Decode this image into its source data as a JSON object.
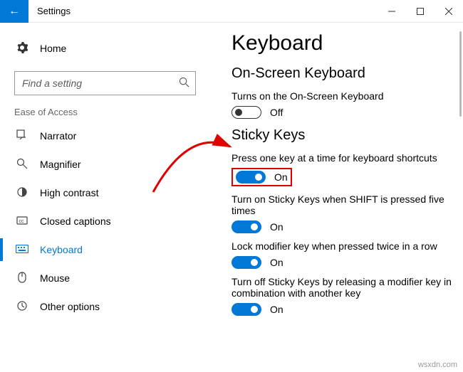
{
  "window": {
    "title": "Settings"
  },
  "sidebar": {
    "home": "Home",
    "search_placeholder": "Find a setting",
    "section": "Ease of Access",
    "items": [
      {
        "id": "narrator",
        "label": "Narrator",
        "active": false
      },
      {
        "id": "magnifier",
        "label": "Magnifier",
        "active": false
      },
      {
        "id": "high-contrast",
        "label": "High contrast",
        "active": false
      },
      {
        "id": "closed-captions",
        "label": "Closed captions",
        "active": false
      },
      {
        "id": "keyboard",
        "label": "Keyboard",
        "active": true
      },
      {
        "id": "mouse",
        "label": "Mouse",
        "active": false
      },
      {
        "id": "other-options",
        "label": "Other options",
        "active": false
      }
    ]
  },
  "content": {
    "page_title": "Keyboard",
    "osk": {
      "heading": "On-Screen Keyboard",
      "label": "Turns on the On-Screen Keyboard",
      "on": false,
      "state_text": "Off"
    },
    "sticky": {
      "heading": "Sticky Keys",
      "s1": {
        "label": "Press one key at a time for keyboard shortcuts",
        "on": true,
        "state_text": "On",
        "highlighted": true
      },
      "s2": {
        "label": "Turn on Sticky Keys when SHIFT is pressed five times",
        "on": true,
        "state_text": "On"
      },
      "s3": {
        "label": "Lock modifier key when pressed twice in a row",
        "on": true,
        "state_text": "On"
      },
      "s4": {
        "label": "Turn off Sticky Keys by releasing a modifier key in combination with another key",
        "on": true,
        "state_text": "On"
      }
    }
  },
  "watermark": "wsxdn.com"
}
